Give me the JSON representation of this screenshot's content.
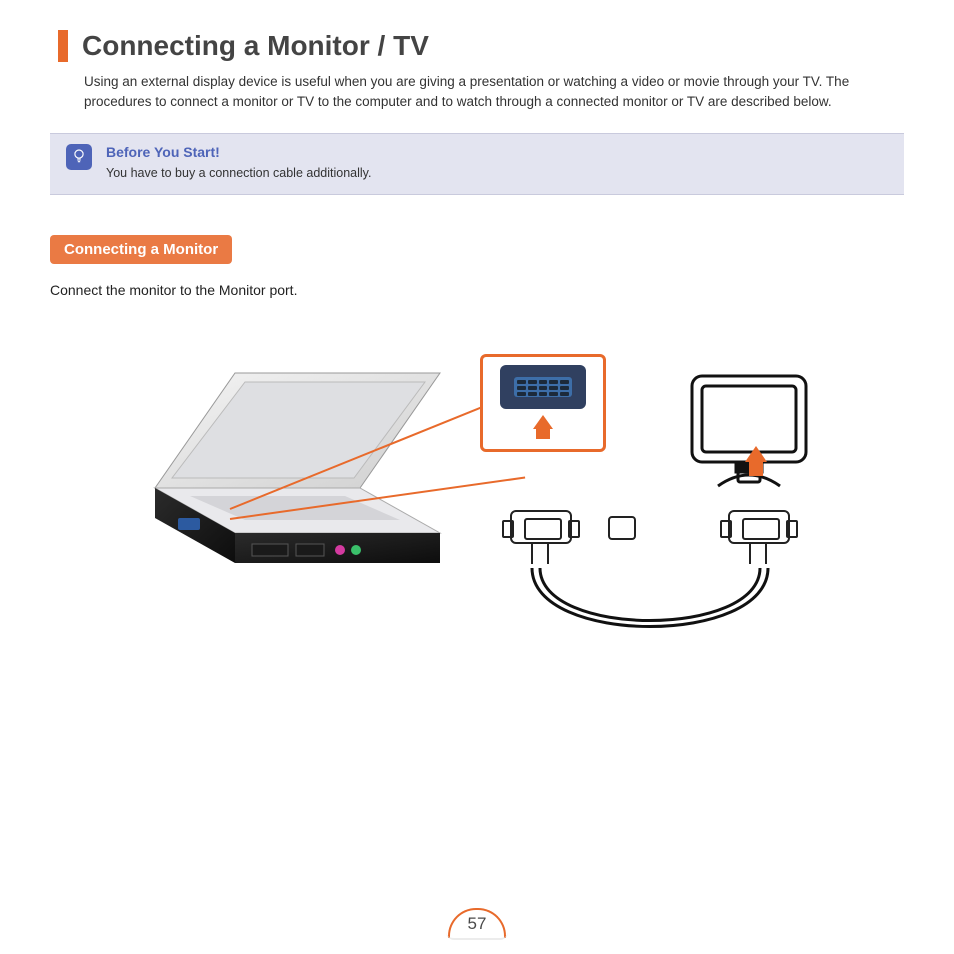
{
  "title": "Connecting a Monitor / TV",
  "intro": "Using an external display device is useful when you are giving a presentation or watching a video or movie through your TV. The procedures to connect a monitor or TV to the computer and to watch through a connected monitor or TV are described below.",
  "note": {
    "heading": "Before You Start!",
    "text": "You have to buy a connection cable additionally."
  },
  "section_heading": "Connecting a Monitor",
  "instruction": "Connect the monitor to the Monitor port.",
  "page_number": "57",
  "icons": {
    "tip": "lightbulb-icon",
    "port": "vga-port-icon",
    "monitor": "external-monitor-icon",
    "laptop": "laptop-icon",
    "cable": "vga-cable-icon"
  },
  "colors": {
    "accent": "#e86a2b",
    "note_bg": "#e3e4f0",
    "note_title": "#4e64b8"
  }
}
